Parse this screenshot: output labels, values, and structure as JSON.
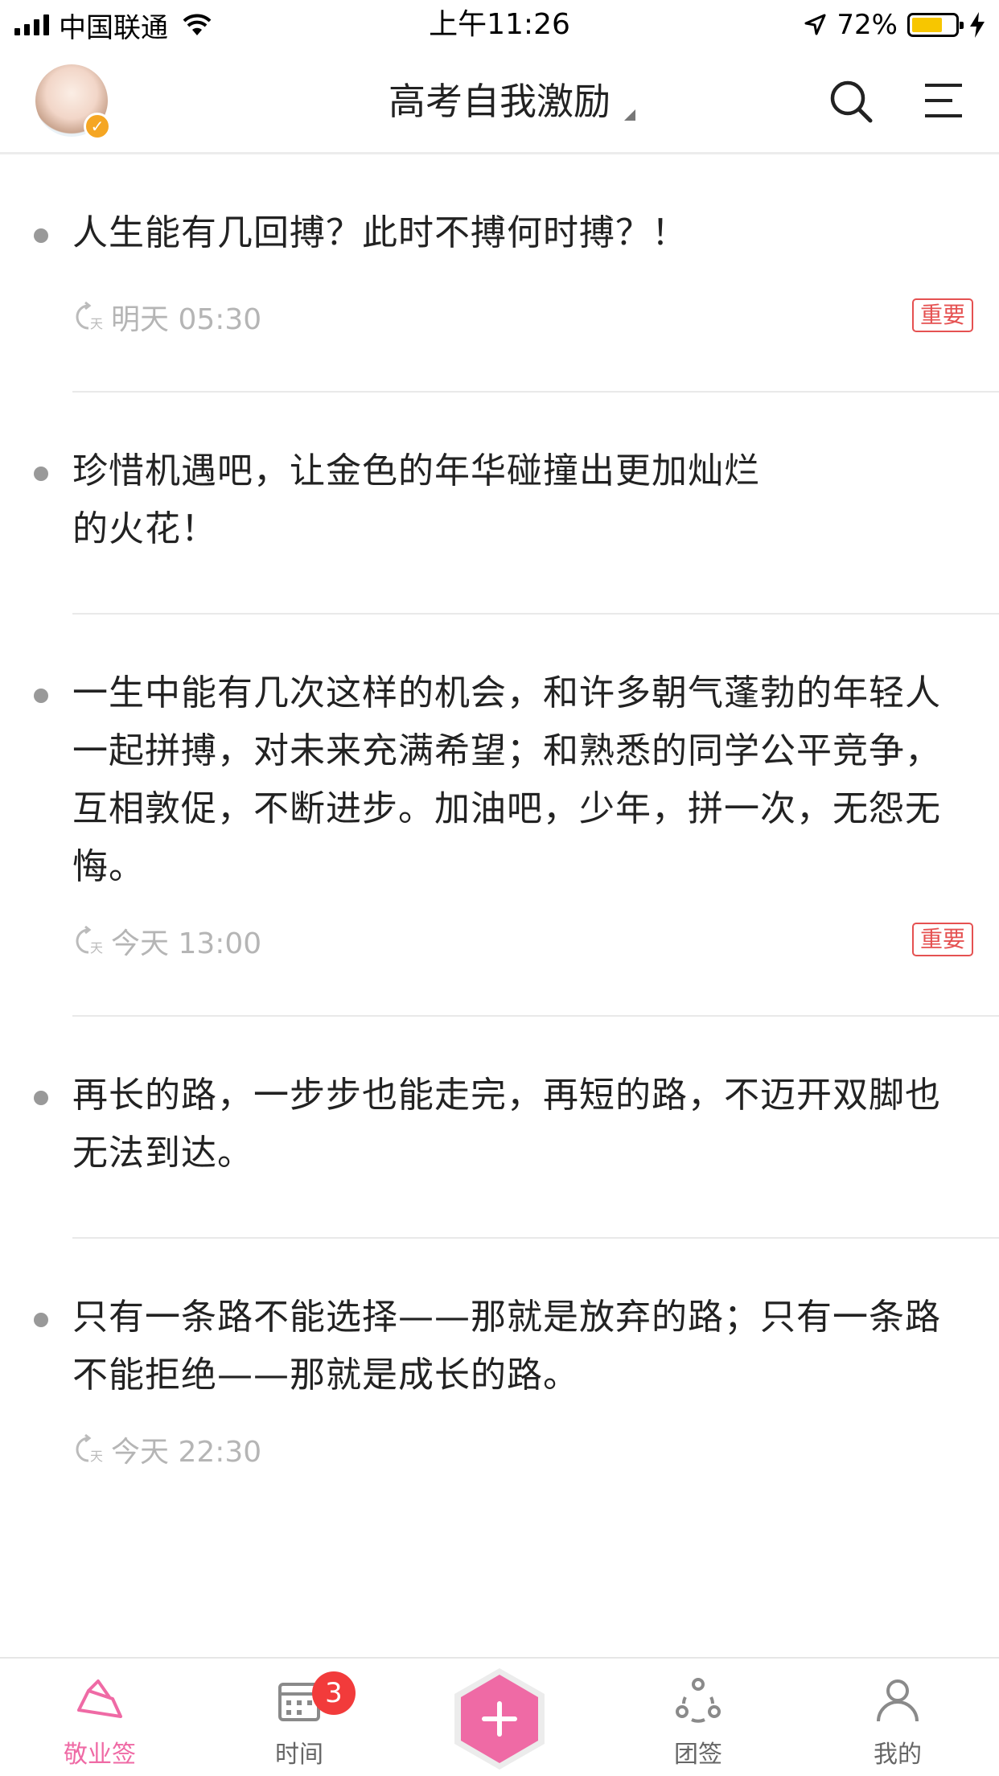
{
  "status_bar": {
    "carrier": "中国联通",
    "time": "上午11:26",
    "battery": "72%",
    "battery_level": 0.72
  },
  "header": {
    "title": "高考自我激励",
    "icons": {
      "avatar": "user-avatar",
      "search": "search-icon",
      "menu": "menu-icon"
    }
  },
  "notes": [
    {
      "text": "人生能有几回搏？此时不搏何时搏？！",
      "reminder": "明天 05:30",
      "tag": "重要"
    },
    {
      "text": "珍惜机遇吧，让金色的年华碰撞出更加灿烂\n的火花！"
    },
    {
      "text": "一生中能有几次这样的机会，和许多朝气蓬勃的年轻人一起拼搏，对未来充满希望；和熟悉的同学公平竞争，互相敦促，不断进步。加油吧，少年，拼一次，无怨无悔。",
      "reminder": "今天 13:00",
      "tag": "重要"
    },
    {
      "text": "再长的路，一步步也能走完，再短的路，不迈开双脚也无法到达。"
    },
    {
      "text": "只有一条路不能选择——那就是放弃的路；只有一条路不能拒绝——那就是成长的路。",
      "reminder": "今天 22:30"
    }
  ],
  "tabs": [
    {
      "label": "敬业签",
      "icon": "notes-icon",
      "active": true
    },
    {
      "label": "时间",
      "icon": "calendar-icon",
      "badge": "3"
    },
    {
      "label": "",
      "icon": "add-icon"
    },
    {
      "label": "团签",
      "icon": "team-icon"
    },
    {
      "label": "我的",
      "icon": "profile-icon"
    }
  ],
  "colors": {
    "accent": "#ef6aa5",
    "tag": "#e55151",
    "badge": "#f23b3b",
    "battery": "#f7c600"
  }
}
